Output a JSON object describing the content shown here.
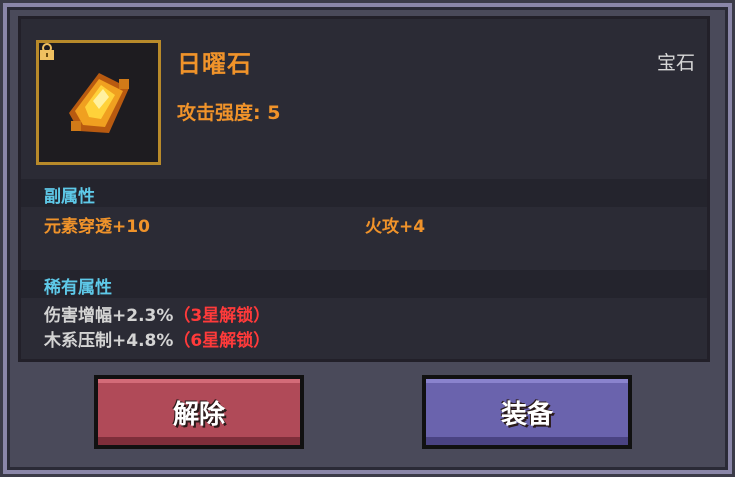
{
  "item": {
    "name": "日曜石",
    "type": "宝石",
    "main_stat": "攻击强度: 5",
    "icon": "golden-scroll-icon",
    "locked": true
  },
  "sub_attributes": {
    "header": "副属性",
    "items": [
      "元素穿透+10",
      "火攻+4"
    ]
  },
  "rare_attributes": {
    "header": "稀有属性",
    "items": [
      {
        "text": "伤害增幅+2.3%",
        "lock_note": "（3星解锁）"
      },
      {
        "text": "木系压制+4.8%",
        "lock_note": "（6星解锁）"
      }
    ]
  },
  "buttons": {
    "unequip_label": "解除",
    "equip_label": "装备"
  },
  "colors": {
    "title": "#f0932a",
    "section_header": "#5ec9e8",
    "lock_note": "#ff3a3a",
    "unequip_button": "#b04a58",
    "equip_button": "#6a63ad"
  }
}
